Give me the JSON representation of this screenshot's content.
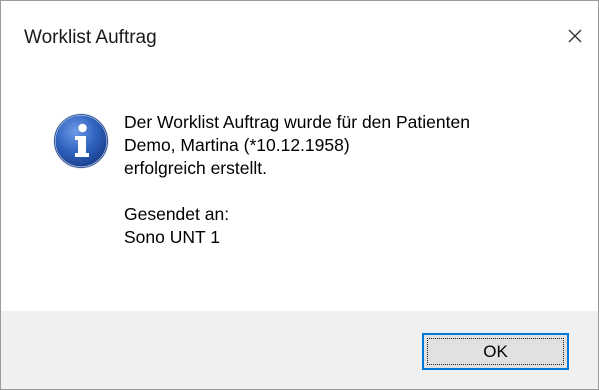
{
  "window": {
    "title": "Worklist Auftrag",
    "close_icon": "close-icon"
  },
  "message": {
    "icon": "info-icon",
    "line1": "Der Worklist Auftrag wurde für den Patienten",
    "line2": "Demo, Martina (*10.12.1958)",
    "line3": "erfolgreich erstellt.",
    "line4": "Gesendet an:",
    "line5": "Sono UNT 1"
  },
  "buttons": {
    "ok_label": "OK"
  },
  "colors": {
    "accent": "#0078d7",
    "footer_bg": "#f0f0f0",
    "icon_blue": "#2a5db0"
  }
}
